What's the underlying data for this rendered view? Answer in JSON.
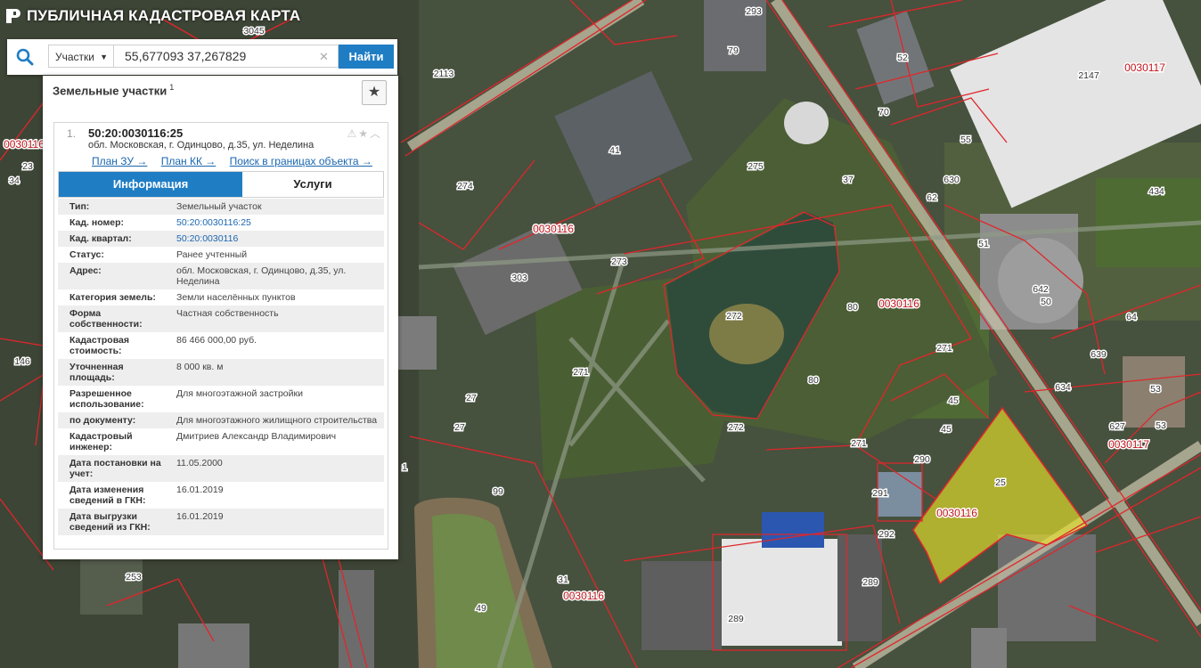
{
  "app": {
    "title": "ПУБЛИЧНАЯ КАДАСТРОВАЯ КАРТА",
    "logo_icon": "registry-logo-icon"
  },
  "search": {
    "type_label": "Участки",
    "query": "55,677093 37,267829",
    "button": "Найти",
    "icons": {
      "search": "magnifier-icon",
      "clear": "close-icon",
      "dropdown": "chevron-down-icon"
    }
  },
  "panel": {
    "title": "Земельные участки",
    "count": "1",
    "favorite_icon": "star-icon",
    "item": {
      "index": "1.",
      "number": "50:20:0030116:25",
      "address": "обл. Московская, г. Одинцово, д.35, ул. Неделина",
      "tools_icons": [
        "warning-icon",
        "star-icon",
        "chevron-up-icon"
      ],
      "links": [
        "План ЗУ →",
        "План КК →",
        "Поиск в границах объекта →"
      ],
      "tabs": [
        "Информация",
        "Услуги"
      ],
      "active_tab": "Информация",
      "attributes": [
        {
          "key": "Тип:",
          "value": "Земельный участок"
        },
        {
          "key": "Кад. номер:",
          "value": "50:20:0030116:25",
          "link": true
        },
        {
          "key": "Кад. квартал:",
          "value": "50:20:0030116",
          "link": true
        },
        {
          "key": "Статус:",
          "value": "Ранее учтенный"
        },
        {
          "key": "Адрес:",
          "value": "обл. Московская, г. Одинцово, д.35, ул. Неделина"
        },
        {
          "key": "Категория земель:",
          "value": "Земли населённых пунктов"
        },
        {
          "key": "Форма собственности:",
          "value": "Частная собственность"
        },
        {
          "key": "Кадастровая стоимость:",
          "value": "86 466 000,00 руб."
        },
        {
          "key": "Уточненная площадь:",
          "value": "8 000 кв. м"
        },
        {
          "key": "Разрешенное использование:",
          "value": "Для многоэтажной застройки"
        },
        {
          "key": "по документу:",
          "value": "Для многоэтажного жилищного строительства"
        },
        {
          "key": "Кадастровый инженер:",
          "value": "Дмитриев Александр Владимирович"
        },
        {
          "key": "Дата постановки на учет:",
          "value": "11.05.2000"
        },
        {
          "key": "Дата изменения сведений в ГКН:",
          "value": "16.01.2019"
        },
        {
          "key": "Дата выгрузки сведений из ГКН:",
          "value": "16.01.2019"
        }
      ]
    }
  },
  "map": {
    "colors": {
      "boundary": "#e0262b",
      "highlight": "#e8e22a",
      "quarter_label": "#c0121a"
    },
    "quarter_labels": [
      "0030116",
      "0030116",
      "0030116",
      "0030116",
      "0030117",
      "0030117",
      "0030116"
    ],
    "parcel_labels": [
      "3045",
      "2113",
      "79",
      "293",
      "52",
      "70",
      "2147",
      "55",
      "630",
      "62",
      "41",
      "275",
      "274",
      "37",
      "434",
      "51",
      "642",
      "50",
      "64",
      "639",
      "53",
      "53",
      "634",
      "627",
      "273",
      "303",
      "272",
      "80",
      "271",
      "80",
      "272",
      "271",
      "45",
      "45",
      "25",
      "290",
      "291",
      "292",
      "27",
      "27",
      "271",
      "99",
      "31",
      "49",
      "289",
      "289",
      "253",
      "146",
      "34",
      "23",
      "1"
    ]
  }
}
